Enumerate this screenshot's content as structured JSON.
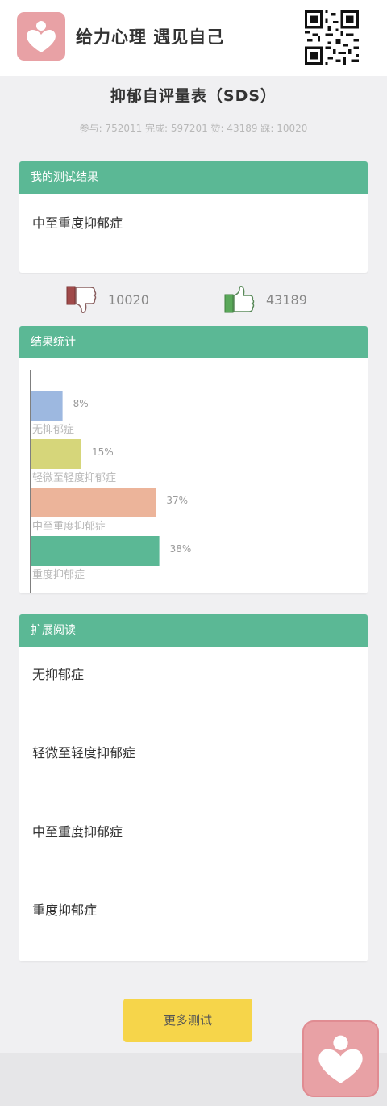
{
  "brand": {
    "slogan": "给力心理  遇见自己"
  },
  "page": {
    "title": "抑郁自评量表（SDS）",
    "stats": "参与: 752011 完成: 597201 赞: 43189 踩: 10020"
  },
  "my_result": {
    "header": "我的测试结果",
    "value": "中至重度抑郁症"
  },
  "votes": {
    "dislike_count": "10020",
    "like_count": "43189",
    "dislike_color": "#a04a4a",
    "like_color": "#5aa85a"
  },
  "result_stats": {
    "header": "结果统计"
  },
  "chart_data": {
    "type": "bar",
    "orientation": "horizontal",
    "categories": [
      "无抑郁症",
      "轻微至轻度抑郁症",
      "中至重度抑郁症",
      "重度抑郁症"
    ],
    "values": [
      8,
      15,
      37,
      38
    ],
    "value_labels": [
      "8%",
      "15%",
      "37%",
      "38%"
    ],
    "colors": [
      "#9db8e0",
      "#d6d67a",
      "#ecb49a",
      "#5bb895"
    ],
    "unit": "%"
  },
  "reading": {
    "header": "扩展阅读",
    "items": [
      "无抑郁症",
      "轻微至轻度抑郁症",
      "中至重度抑郁症",
      "重度抑郁症"
    ]
  },
  "more_button": {
    "label": "更多测试"
  },
  "theme": {
    "accent": "#5bb895",
    "brand_pink": "#e8a1a5",
    "button_yellow": "#f6d54a"
  }
}
